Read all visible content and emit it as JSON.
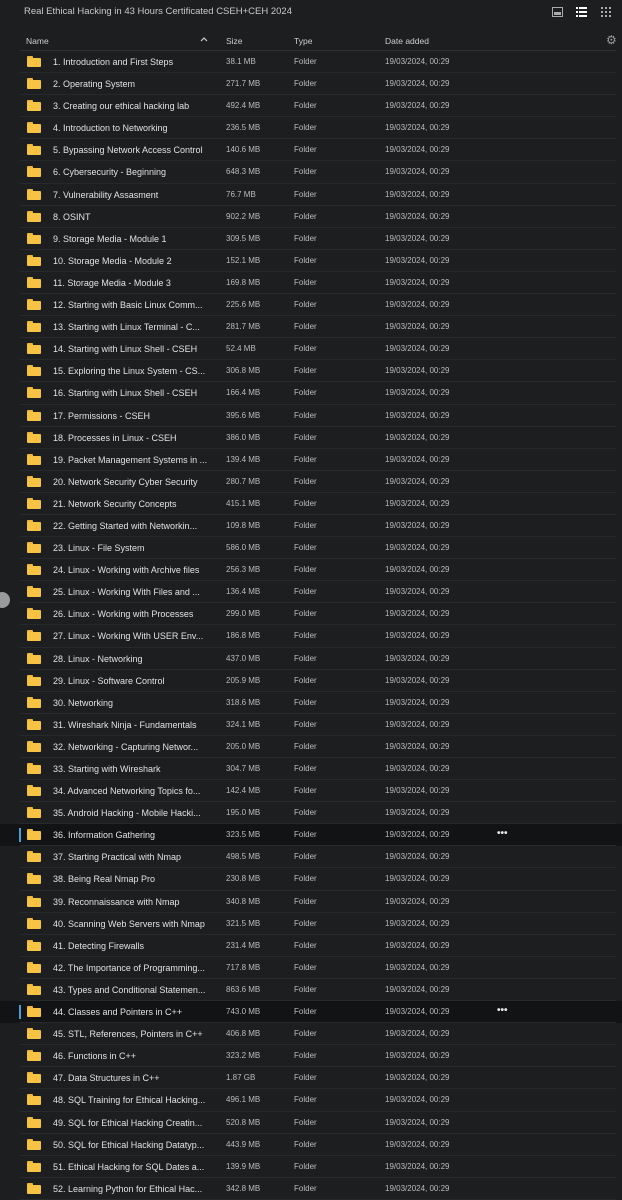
{
  "window": {
    "title": "Real Ethical Hacking in 43 Hours Certificated CSEH+CEH 2024"
  },
  "toolbar": {
    "icons": [
      "panel-icon",
      "list-view-icon",
      "grid-view-icon"
    ]
  },
  "columns": {
    "name": "Name",
    "size": "Size",
    "type": "Type",
    "date": "Date added"
  },
  "sort": {
    "column": "name",
    "direction": "ascending",
    "icon": "chevron-up-icon"
  },
  "colors": {
    "folder": "#f6c342",
    "selection_bar": "#4a9fd8",
    "background": "#1d1e20"
  },
  "rows": [
    {
      "name": "1. Introduction and First Steps",
      "size": "38.1 MB",
      "type": "Folder",
      "date": "19/03/2024, 00:29"
    },
    {
      "name": "2. Operating System",
      "size": "271.7 MB",
      "type": "Folder",
      "date": "19/03/2024, 00:29"
    },
    {
      "name": "3. Creating our ethical hacking lab",
      "size": "492.4 MB",
      "type": "Folder",
      "date": "19/03/2024, 00:29"
    },
    {
      "name": "4. Introduction to Networking",
      "size": "236.5 MB",
      "type": "Folder",
      "date": "19/03/2024, 00:29"
    },
    {
      "name": "5. Bypassing Network Access Control",
      "size": "140.6 MB",
      "type": "Folder",
      "date": "19/03/2024, 00:29"
    },
    {
      "name": "6. Cybersecurity - Beginning",
      "size": "648.3 MB",
      "type": "Folder",
      "date": "19/03/2024, 00:29"
    },
    {
      "name": "7. Vulnerability Assasment",
      "size": "76.7 MB",
      "type": "Folder",
      "date": "19/03/2024, 00:29"
    },
    {
      "name": "8. OSINT",
      "size": "902.2 MB",
      "type": "Folder",
      "date": "19/03/2024, 00:29"
    },
    {
      "name": "9. Storage Media - Module 1",
      "size": "309.5 MB",
      "type": "Folder",
      "date": "19/03/2024, 00:29"
    },
    {
      "name": "10. Storage Media - Module 2",
      "size": "152.1 MB",
      "type": "Folder",
      "date": "19/03/2024, 00:29"
    },
    {
      "name": "11. Storage Media - Module 3",
      "size": "169.8 MB",
      "type": "Folder",
      "date": "19/03/2024, 00:29"
    },
    {
      "name": "12. Starting with Basic Linux Comm...",
      "size": "225.6 MB",
      "type": "Folder",
      "date": "19/03/2024, 00:29"
    },
    {
      "name": "13. Starting with Linux Terminal - C...",
      "size": "281.7 MB",
      "type": "Folder",
      "date": "19/03/2024, 00:29"
    },
    {
      "name": "14. Starting with Linux Shell - CSEH",
      "size": "52.4 MB",
      "type": "Folder",
      "date": "19/03/2024, 00:29"
    },
    {
      "name": "15. Exploring the Linux System - CS...",
      "size": "306.8 MB",
      "type": "Folder",
      "date": "19/03/2024, 00:29"
    },
    {
      "name": "16. Starting with Linux Shell - CSEH",
      "size": "166.4 MB",
      "type": "Folder",
      "date": "19/03/2024, 00:29"
    },
    {
      "name": "17. Permissions - CSEH",
      "size": "395.6 MB",
      "type": "Folder",
      "date": "19/03/2024, 00:29"
    },
    {
      "name": "18. Processes in Linux - CSEH",
      "size": "386.0 MB",
      "type": "Folder",
      "date": "19/03/2024, 00:29"
    },
    {
      "name": "19. Packet Management Systems in ...",
      "size": "139.4 MB",
      "type": "Folder",
      "date": "19/03/2024, 00:29"
    },
    {
      "name": "20. Network Security Cyber Security",
      "size": "280.7 MB",
      "type": "Folder",
      "date": "19/03/2024, 00:29"
    },
    {
      "name": "21. Network Security Concepts",
      "size": "415.1 MB",
      "type": "Folder",
      "date": "19/03/2024, 00:29"
    },
    {
      "name": "22. Getting Started with Networkin...",
      "size": "109.8 MB",
      "type": "Folder",
      "date": "19/03/2024, 00:29"
    },
    {
      "name": "23. Linux - File System",
      "size": "586.0 MB",
      "type": "Folder",
      "date": "19/03/2024, 00:29"
    },
    {
      "name": "24. Linux - Working with Archive files",
      "size": "256.3 MB",
      "type": "Folder",
      "date": "19/03/2024, 00:29"
    },
    {
      "name": "25. Linux - Working With Files and ...",
      "size": "136.4 MB",
      "type": "Folder",
      "date": "19/03/2024, 00:29"
    },
    {
      "name": "26. Linux - Working with Processes",
      "size": "299.0 MB",
      "type": "Folder",
      "date": "19/03/2024, 00:29"
    },
    {
      "name": "27. Linux - Working With USER Env...",
      "size": "186.8 MB",
      "type": "Folder",
      "date": "19/03/2024, 00:29"
    },
    {
      "name": "28. Linux - Networking",
      "size": "437.0 MB",
      "type": "Folder",
      "date": "19/03/2024, 00:29"
    },
    {
      "name": "29. Linux - Software Control",
      "size": "205.9 MB",
      "type": "Folder",
      "date": "19/03/2024, 00:29"
    },
    {
      "name": "30. Networking",
      "size": "318.6 MB",
      "type": "Folder",
      "date": "19/03/2024, 00:29"
    },
    {
      "name": "31. Wireshark Ninja - Fundamentals",
      "size": "324.1 MB",
      "type": "Folder",
      "date": "19/03/2024, 00:29"
    },
    {
      "name": "32. Networking - Capturing Networ...",
      "size": "205.0 MB",
      "type": "Folder",
      "date": "19/03/2024, 00:29"
    },
    {
      "name": "33. Starting with Wireshark",
      "size": "304.7 MB",
      "type": "Folder",
      "date": "19/03/2024, 00:29"
    },
    {
      "name": "34. Advanced Networking Topics fo...",
      "size": "142.4 MB",
      "type": "Folder",
      "date": "19/03/2024, 00:29"
    },
    {
      "name": "35. Android Hacking - Mobile Hacki...",
      "size": "195.0 MB",
      "type": "Folder",
      "date": "19/03/2024, 00:29"
    },
    {
      "name": "36. Information Gathering",
      "size": "323.5 MB",
      "type": "Folder",
      "date": "19/03/2024, 00:29",
      "selected": true,
      "more": "•••"
    },
    {
      "name": "37. Starting Practical with Nmap",
      "size": "498.5 MB",
      "type": "Folder",
      "date": "19/03/2024, 00:29"
    },
    {
      "name": "38. Being Real Nmap Pro",
      "size": "230.8 MB",
      "type": "Folder",
      "date": "19/03/2024, 00:29"
    },
    {
      "name": "39. Reconnaissance with Nmap",
      "size": "340.8 MB",
      "type": "Folder",
      "date": "19/03/2024, 00:29"
    },
    {
      "name": "40. Scanning Web Servers with Nmap",
      "size": "321.5 MB",
      "type": "Folder",
      "date": "19/03/2024, 00:29"
    },
    {
      "name": "41. Detecting Firewalls",
      "size": "231.4 MB",
      "type": "Folder",
      "date": "19/03/2024, 00:29"
    },
    {
      "name": "42. The Importance of Programming...",
      "size": "717.8 MB",
      "type": "Folder",
      "date": "19/03/2024, 00:29"
    },
    {
      "name": "43. Types and Conditional Statemen...",
      "size": "863.6 MB",
      "type": "Folder",
      "date": "19/03/2024, 00:29"
    },
    {
      "name": "44. Classes and Pointers in C++",
      "size": "743.0 MB",
      "type": "Folder",
      "date": "19/03/2024, 00:29",
      "selected": true,
      "more": "•••"
    },
    {
      "name": "45. STL, References, Pointers in C++",
      "size": "406.8 MB",
      "type": "Folder",
      "date": "19/03/2024, 00:29"
    },
    {
      "name": "46. Functions in C++",
      "size": "323.2 MB",
      "type": "Folder",
      "date": "19/03/2024, 00:29"
    },
    {
      "name": "47. Data Structures in C++",
      "size": "1.87 GB",
      "type": "Folder",
      "date": "19/03/2024, 00:29"
    },
    {
      "name": "48. SQL Training for Ethical Hacking...",
      "size": "496.1 MB",
      "type": "Folder",
      "date": "19/03/2024, 00:29"
    },
    {
      "name": "49. SQL for Ethical Hacking Creatin...",
      "size": "520.8 MB",
      "type": "Folder",
      "date": "19/03/2024, 00:29"
    },
    {
      "name": "50. SQL for Ethical Hacking Datatyp...",
      "size": "443.9 MB",
      "type": "Folder",
      "date": "19/03/2024, 00:29"
    },
    {
      "name": "51. Ethical Hacking for SQL Dates a...",
      "size": "139.9 MB",
      "type": "Folder",
      "date": "19/03/2024, 00:29"
    },
    {
      "name": "52. Learning Python for Ethical Hac...",
      "size": "342.8 MB",
      "type": "Folder",
      "date": "19/03/2024, 00:29"
    }
  ]
}
